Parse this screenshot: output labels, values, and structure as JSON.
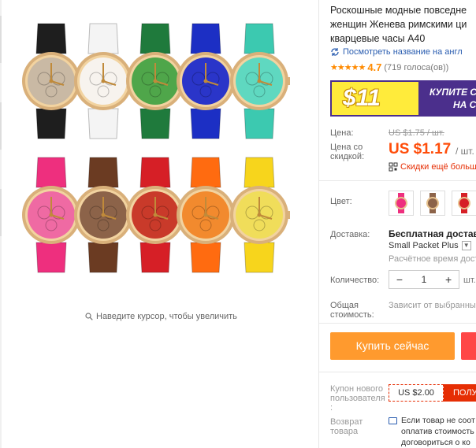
{
  "gallery": {
    "zoom_hint": "Наведите курсор, чтобы увеличить",
    "watches_top": [
      {
        "strap": "#1e1e1e",
        "dial": "#c9b9a4"
      },
      {
        "strap": "#f4f4f4",
        "dial": "#f7f3ee"
      },
      {
        "strap": "#1f7a3c",
        "dial": "#4fa64a"
      },
      {
        "strap": "#1c2fc4",
        "dial": "#2a35c9"
      },
      {
        "strap": "#3cc9b0",
        "dial": "#5fd8c0"
      }
    ],
    "watches_bottom": [
      {
        "strap": "#ee2f7e",
        "dial": "#ef6aa3"
      },
      {
        "strap": "#6b3b22",
        "dial": "#8c6349"
      },
      {
        "strap": "#d61f26",
        "dial": "#c93a2a"
      },
      {
        "strap": "#ff6b10",
        "dial": "#f28a2e"
      },
      {
        "strap": "#f7d51c",
        "dial": "#f0dd5a"
      }
    ]
  },
  "product": {
    "title_lines": [
      "Роскошные модные повседне",
      "женщин Женева римскими ци",
      "кварцевые часы A40"
    ],
    "translate_link": "Посмотреть название на англ",
    "rating": "4.7",
    "votes": "(719 голоса(ов))",
    "banner_price": "$11",
    "banner_text_1": "КУПИТЕ С",
    "banner_text_2": "НА С"
  },
  "pricing": {
    "price_label": "Цена:",
    "old_price": "US $1.75 / шт.",
    "discount_label_1": "Цена со",
    "discount_label_2": "скидкой:",
    "new_price": "US $1.17",
    "unit": "/ шт.",
    "coupon_link": "Скидки ещё больш"
  },
  "options": {
    "color_label": "Цвет:",
    "swatches": [
      "#ee2f7e",
      "#8c6349",
      "#d61f26"
    ],
    "shipping_label": "Доставка:",
    "shipping_main": "Бесплатная доставка",
    "shipping_method": "Small Packet Plus",
    "shipping_est": "Расчётное время дост",
    "quantity_label": "Количество:",
    "qty_minus": "−",
    "qty_value": "1",
    "qty_plus": "+",
    "qty_unit": "шт.",
    "total_label_1": "Общая",
    "total_label_2": "стоимость:",
    "total_value": "Зависит от выбранны"
  },
  "actions": {
    "buy_now": "Купить сейчас"
  },
  "coupon": {
    "label_1": "Купон нового",
    "label_2": "пользователя",
    "label_3": ":",
    "value": "US $2.00",
    "button": "ПОЛУ"
  },
  "returns": {
    "label_1": "Возврат",
    "label_2": "товара",
    "line_1": "Если товар не соот",
    "line_2": "оплатив стоимость",
    "line_3": "договориться о ко"
  }
}
